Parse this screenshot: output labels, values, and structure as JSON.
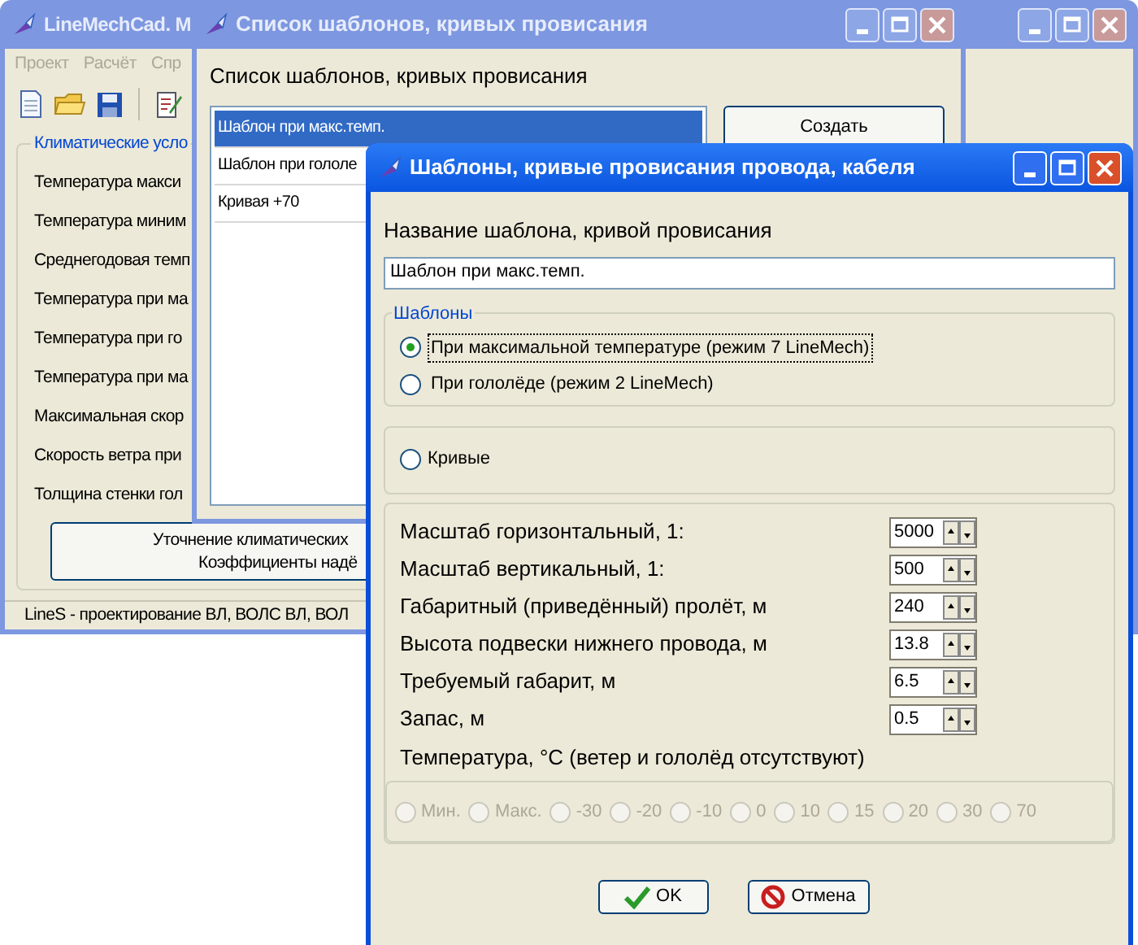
{
  "main_window": {
    "title": "LineMechCad. М",
    "menu": [
      {
        "label": "Проект",
        "disabled": true
      },
      {
        "label": "Расчёт",
        "disabled": true
      },
      {
        "label": "Спр",
        "disabled": true
      }
    ],
    "group_title": "Климатические усло",
    "fields": [
      "Температура макси",
      "Температура миним",
      "Среднегодовая темп",
      "Температура при ма",
      "Температура при го",
      "Температура при ма",
      "Максимальная скор",
      "Скорость ветра при",
      "Толщина стенки гол"
    ],
    "button_lines": [
      "Уточнение климатических",
      "Коэффициенты надё"
    ],
    "status_bar": "LineS - проектирование ВЛ, ВОЛС ВЛ, ВОЛ"
  },
  "list_window": {
    "title": "Список шаблонов, кривых провисания",
    "heading": "Список шаблонов, кривых провисания",
    "items": [
      {
        "label": "Шаблон при макс.темп.",
        "selected": true
      },
      {
        "label": "Шаблон при гололе",
        "selected": false
      },
      {
        "label": "Кривая +70",
        "selected": false
      }
    ],
    "create_button": "Создать"
  },
  "dialog": {
    "title": "Шаблоны, кривые провисания провода, кабеля",
    "name_label": "Название шаблона, кривой провисания",
    "name_value": "Шаблон при макс.темп.",
    "templates_group": "Шаблоны",
    "templates": [
      {
        "label": "При максимальной температуре (режим 7 LineMech)",
        "selected": true
      },
      {
        "label": "При гололёде (режим 2 LineMech)",
        "selected": false
      }
    ],
    "curves": {
      "label": "Кривые",
      "selected": false
    },
    "params": [
      {
        "label": "Масштаб горизонтальный, 1:",
        "value": "5000"
      },
      {
        "label": "Масштаб вертикальный, 1:",
        "value": "500"
      },
      {
        "label": "Габаритный (приведённый) пролёт, м",
        "value": "240"
      },
      {
        "label": "Высота подвески нижнего провода, м",
        "value": "13.8"
      },
      {
        "label": "Требуемый габарит, м",
        "value": "6.5"
      },
      {
        "label": "Запас, м",
        "value": "0.5"
      }
    ],
    "temperature_label": "Температура, °С (ветер и гололёд отсутствуют)",
    "temperatures_disabled": true,
    "temperatures": [
      {
        "label": "Мин.",
        "selected": false
      },
      {
        "label": "Макс.",
        "selected": false
      },
      {
        "label": "-30",
        "selected": false
      },
      {
        "label": "-20",
        "selected": false
      },
      {
        "label": "-10",
        "selected": false
      },
      {
        "label": "0",
        "selected": false
      },
      {
        "label": "10",
        "selected": false
      },
      {
        "label": "15",
        "selected": false
      },
      {
        "label": "20",
        "selected": false
      },
      {
        "label": "30",
        "selected": false
      },
      {
        "label": "70",
        "selected": false
      }
    ],
    "ok_button": "OK",
    "cancel_button": "Отмена"
  }
}
